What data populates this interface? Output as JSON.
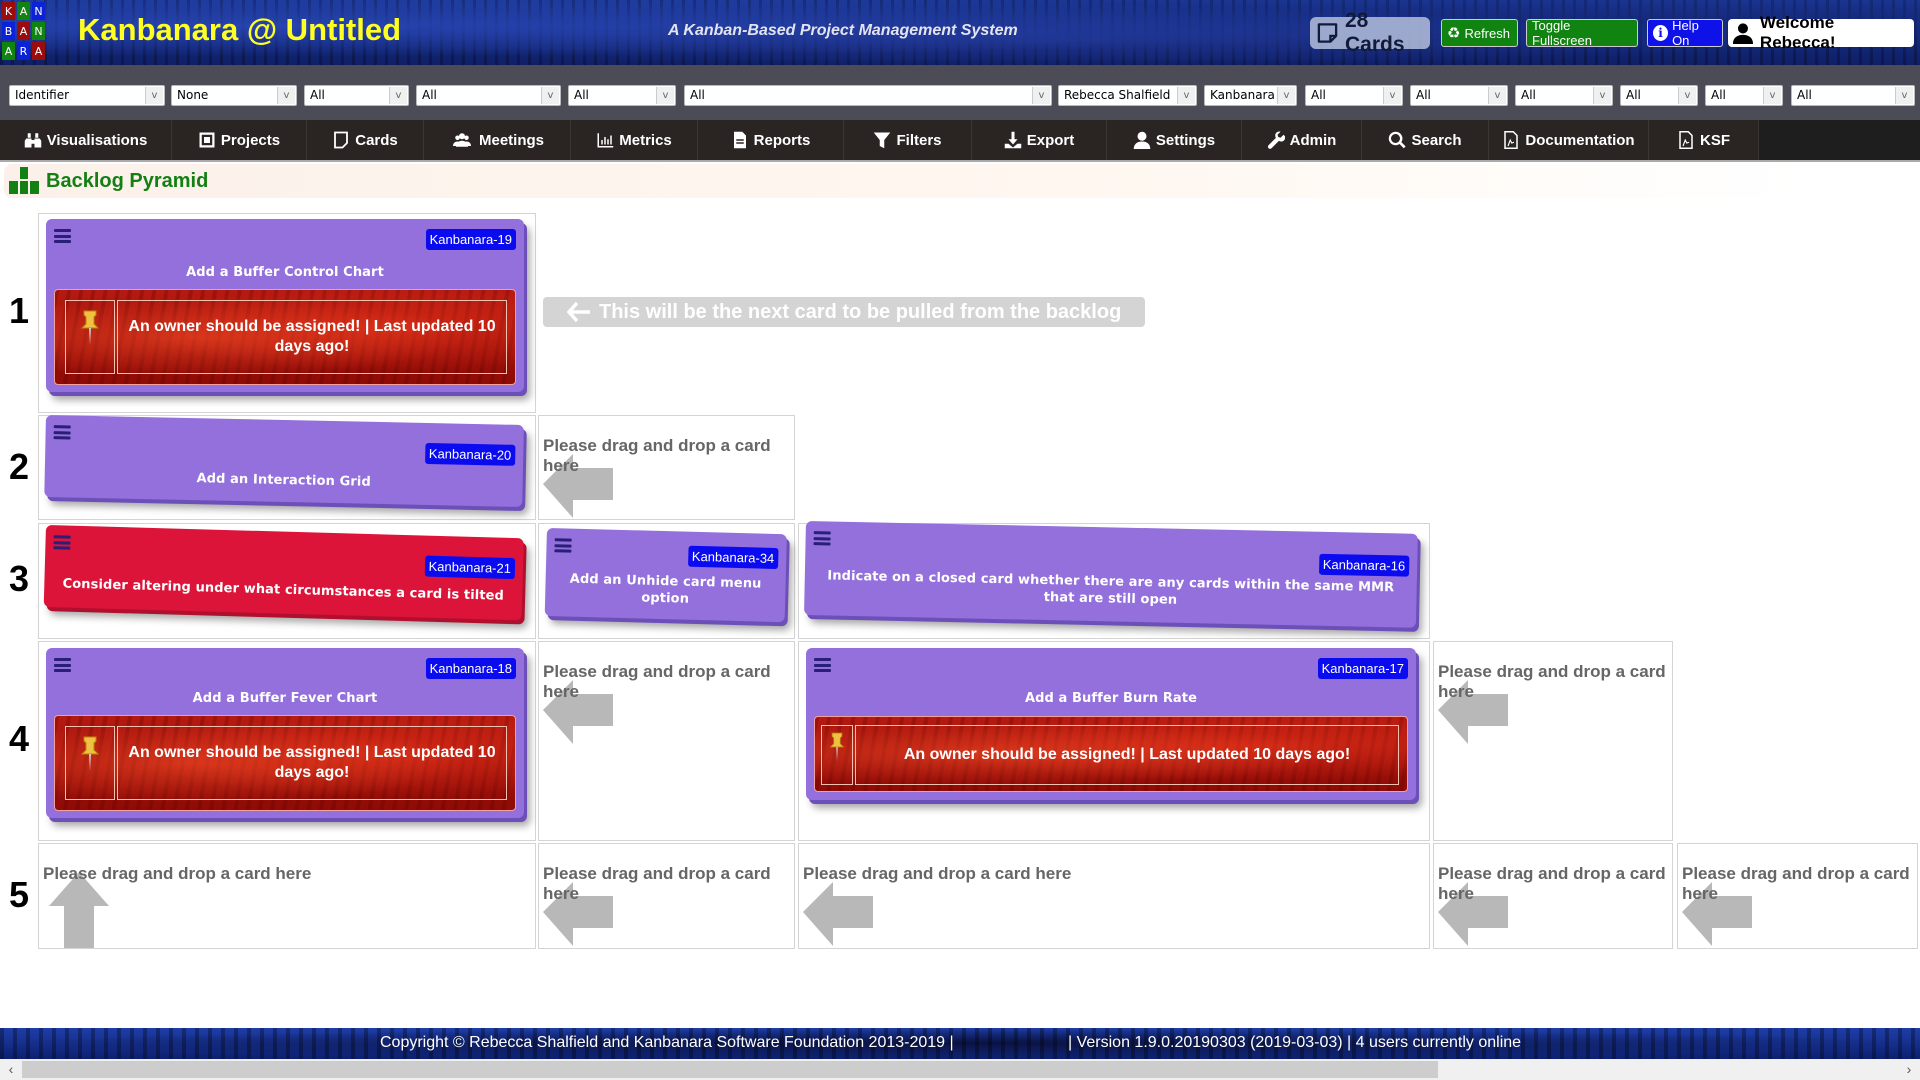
{
  "header": {
    "logo_letters": [
      "K",
      "A",
      "N",
      "B",
      "A",
      "N",
      "A",
      "R",
      "A"
    ],
    "app_title": "Kanbanara @ Untitled",
    "tagline": "A Kanban-Based Project Management System",
    "card_count": "28 Cards",
    "refresh_label": "Refresh",
    "fullscreen_label": "Toggle Fullscreen",
    "help_label": "Help On",
    "welcome_label": "Welcome Rebecca!"
  },
  "filters": [
    {
      "name": "identifier-filter",
      "value": "Identifier"
    },
    {
      "name": "grouping-filter",
      "value": "None"
    },
    {
      "name": "filter-3",
      "value": "All"
    },
    {
      "name": "filter-4",
      "value": "All"
    },
    {
      "name": "filter-5",
      "value": "All"
    },
    {
      "name": "filter-6",
      "value": "All"
    },
    {
      "name": "user-filter",
      "value": "Rebecca Shalfield"
    },
    {
      "name": "project-filter",
      "value": "Kanbanara"
    },
    {
      "name": "filter-9",
      "value": "All"
    },
    {
      "name": "filter-10",
      "value": "All"
    },
    {
      "name": "filter-11",
      "value": "All"
    },
    {
      "name": "filter-12",
      "value": "All"
    },
    {
      "name": "filter-13",
      "value": "All"
    },
    {
      "name": "filter-14",
      "value": "All"
    }
  ],
  "nav": [
    {
      "label": "Visualisations",
      "icon": "binoculars-icon"
    },
    {
      "label": "Projects",
      "icon": "projects-icon"
    },
    {
      "label": "Cards",
      "icon": "card-icon"
    },
    {
      "label": "Meetings",
      "icon": "users-icon"
    },
    {
      "label": "Metrics",
      "icon": "bar-chart-icon"
    },
    {
      "label": "Reports",
      "icon": "report-icon"
    },
    {
      "label": "Filters",
      "icon": "funnel-icon"
    },
    {
      "label": "Export",
      "icon": "download-icon"
    },
    {
      "label": "Settings",
      "icon": "user-settings-icon"
    },
    {
      "label": "Admin",
      "icon": "wrench-icon"
    },
    {
      "label": "Search",
      "icon": "search-icon"
    },
    {
      "label": "Documentation",
      "icon": "pdf-icon"
    },
    {
      "label": "KSF",
      "icon": "pdf-icon"
    }
  ],
  "page": {
    "title": "Backlog Pyramid",
    "next_card_hint": "This will be the next card to be pulled from the backlog",
    "drop_text": "Please drag and drop a card here",
    "row_numbers": [
      "1",
      "2",
      "3",
      "4",
      "5"
    ]
  },
  "cards": {
    "k19": {
      "id": "Kanbanara-19",
      "title": "Add a Buffer Control Chart",
      "warning": "An owner should be assigned! | Last updated 10 days ago!",
      "color": "#9370db"
    },
    "k20": {
      "id": "Kanbanara-20",
      "title": "Add an Interaction Grid",
      "color": "#9370db"
    },
    "k21": {
      "id": "Kanbanara-21",
      "title": "Consider altering under what circumstances a card is tilted",
      "color": "#dc143c"
    },
    "k34": {
      "id": "Kanbanara-34",
      "title": "Add an Unhide card menu option",
      "color": "#9370db"
    },
    "k16": {
      "id": "Kanbanara-16",
      "title": "Indicate on a closed card whether there are any cards within the same MMR that are still open",
      "color": "#9370db"
    },
    "k18": {
      "id": "Kanbanara-18",
      "title": "Add a Buffer Fever Chart",
      "warning": "An owner should be assigned! | Last updated 10 days ago!",
      "color": "#9370db"
    },
    "k17": {
      "id": "Kanbanara-17",
      "title": "Add a Buffer Burn Rate",
      "warning": "An owner should be assigned! | Last updated 10 days ago!",
      "color": "#9370db"
    }
  },
  "footer": {
    "copyright": "Copyright © Rebecca Shalfield and Kanbanara Software Foundation 2013-2019 |",
    "version": "| Version 1.9.0.20190303 (2019-03-03) | 4 users currently online"
  }
}
